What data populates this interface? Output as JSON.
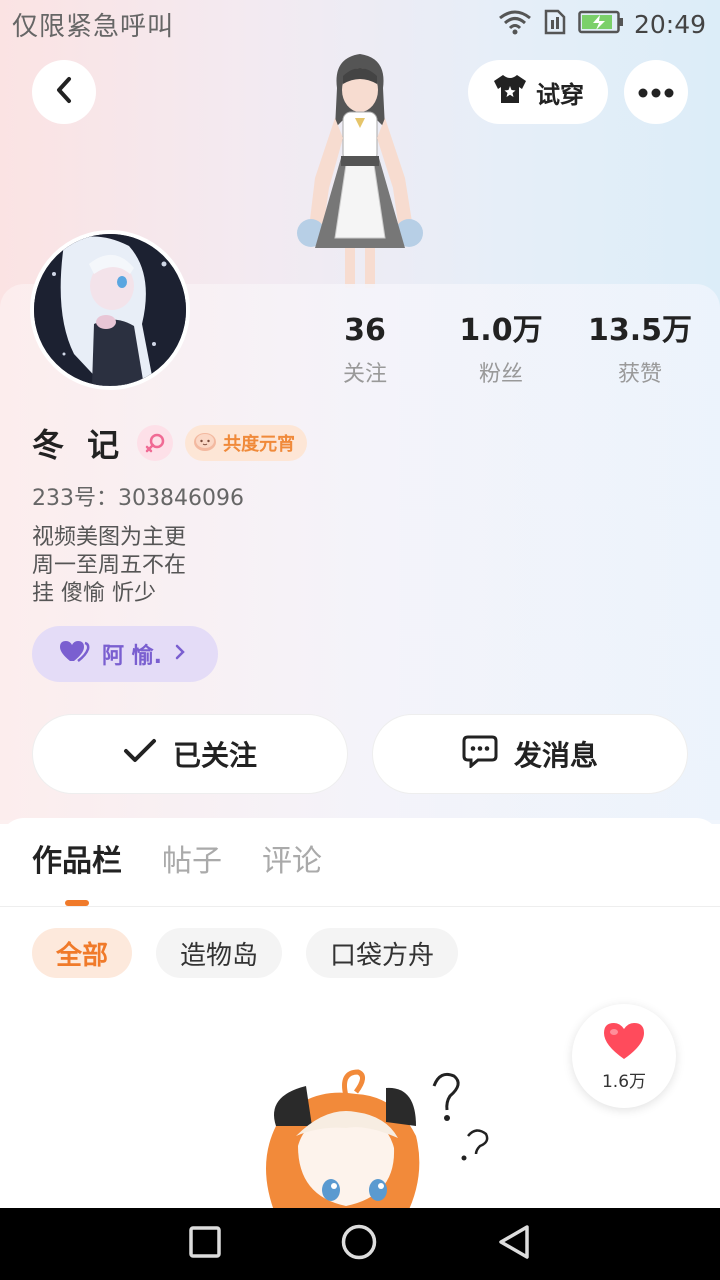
{
  "status_bar": {
    "carrier_text": "仅限紧急呼叫",
    "time": "20:49",
    "icons": [
      "wifi-icon",
      "sim-icon",
      "battery-charging-icon"
    ]
  },
  "header": {
    "back_icon": "chevron-left-icon",
    "tryon_label": "试穿",
    "tryon_icon": "tshirt-icon",
    "more_icon": "more-dots-icon"
  },
  "profile": {
    "name": "冬 记",
    "gender_icon": "female-icon",
    "title_badge": "共度元宵",
    "uid_line": "233号：303846096",
    "bio_lines": [
      "视频美图为主更",
      "周一至周五不在",
      "挂 傻愉 忻少"
    ],
    "partner_label": "阿 愉.",
    "stats": [
      {
        "value": "36",
        "label": "关注"
      },
      {
        "value": "1.0万",
        "label": "粉丝"
      },
      {
        "value": "13.5万",
        "label": "获赞"
      }
    ]
  },
  "actions": {
    "follow_label": "已关注",
    "message_label": "发消息"
  },
  "tabs": [
    {
      "label": "作品栏",
      "active": true
    },
    {
      "label": "帖子",
      "active": false
    },
    {
      "label": "评论",
      "active": false
    }
  ],
  "filters": [
    {
      "label": "全部",
      "active": true
    },
    {
      "label": "造物岛",
      "active": false
    },
    {
      "label": "口袋方舟",
      "active": false
    }
  ],
  "like_fab": {
    "count": "1.6万"
  },
  "colors": {
    "accent": "#f07a2a",
    "partner": "#7a5fd0",
    "like": "#ff4b5c"
  }
}
